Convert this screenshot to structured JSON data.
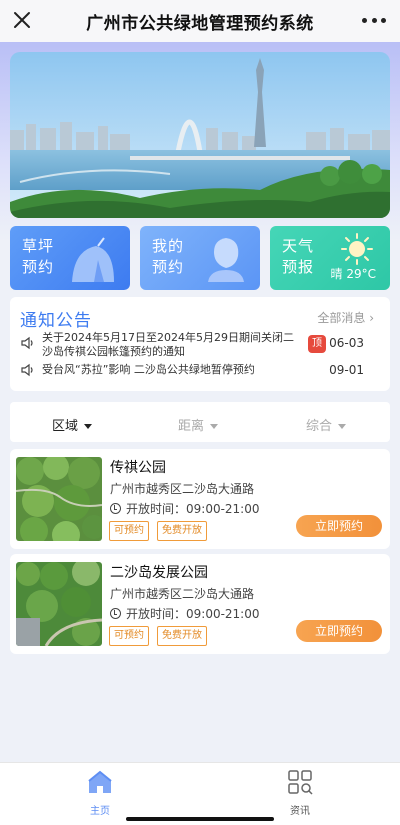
{
  "header": {
    "title": "广州市公共绿地管理预约系统"
  },
  "tiles": [
    {
      "line1": "草坪",
      "line2": "预约"
    },
    {
      "line1": "我的",
      "line2": "预约"
    },
    {
      "line1": "天气",
      "line2": "预报",
      "temp": "晴 29°C"
    }
  ],
  "notice": {
    "title": "通知公告",
    "all_label": "全部消息 ›",
    "items": [
      {
        "text": "关于2024年5月17日至2024年5月29日期间关闭二沙岛传祺公园帐篷预约的通知",
        "pinned": "顶",
        "date": "06-03"
      },
      {
        "text": "受台风“苏拉”影响 二沙岛公共绿地暂停预约",
        "date": "09-01"
      }
    ]
  },
  "filters": [
    {
      "label": "区域"
    },
    {
      "label": "距离"
    },
    {
      "label": "综合"
    }
  ],
  "parks": [
    {
      "name": "传祺公园",
      "address": "广州市越秀区二沙岛大通路",
      "hours": "开放时间：09:00-21:00",
      "tag1": "可预约",
      "tag2": "免费开放",
      "button": "立即预约"
    },
    {
      "name": "二沙岛发展公园",
      "address": "广州市越秀区二沙岛大通路",
      "hours": "开放时间：09:00-21:00",
      "tag1": "可预约",
      "tag2": "免费开放",
      "button": "立即预约"
    }
  ],
  "tabbar": {
    "home": "主页",
    "news": "资讯"
  },
  "colors": {
    "accent": "#3d7bf0",
    "orange": "#f2913a",
    "tab_active": "#5e8ef3"
  }
}
